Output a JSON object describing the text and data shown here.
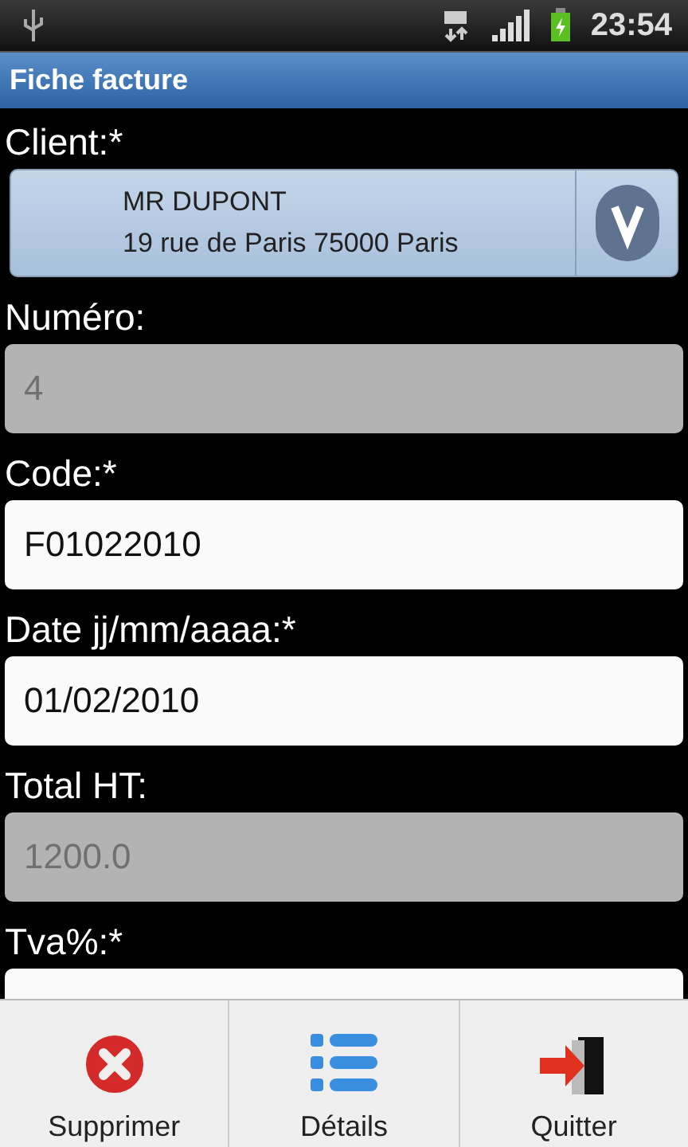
{
  "status_bar": {
    "time": "23:54"
  },
  "window": {
    "title": "Fiche facture"
  },
  "fields": [
    {
      "kind": "spinner",
      "label": "Client:*",
      "lines": [
        "MR DUPONT",
        "19 rue de Paris 75000 Paris"
      ]
    },
    {
      "kind": "text",
      "label": "Numéro:",
      "value": "4",
      "disabled": true
    },
    {
      "kind": "text",
      "label": "Code:*",
      "value": "F01022010",
      "disabled": false
    },
    {
      "kind": "text",
      "label": "Date jj/mm/aaaa:*",
      "value": "01/02/2010",
      "disabled": false
    },
    {
      "kind": "text",
      "label": "Total HT:",
      "value": "1200.0",
      "disabled": true
    },
    {
      "kind": "text",
      "label": "Tva%:*",
      "disabled": false
    }
  ],
  "menu": [
    {
      "kind": "delete",
      "label": "Supprimer"
    },
    {
      "kind": "details",
      "label": "Détails"
    },
    {
      "kind": "quit",
      "label": "Quitter"
    }
  ]
}
